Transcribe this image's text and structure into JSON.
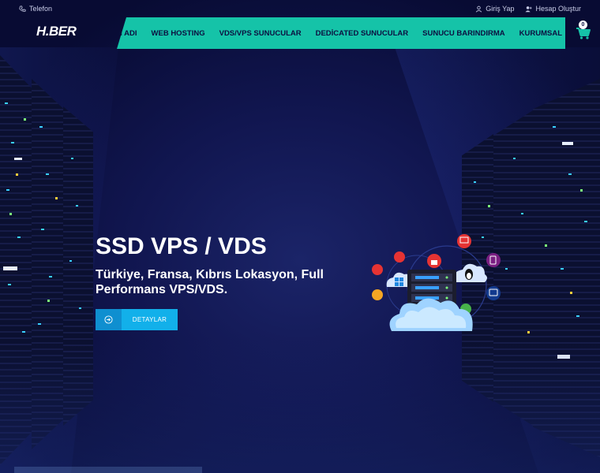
{
  "topbar": {
    "phone_label": "Telefon",
    "login_label": "Giriş Yap",
    "register_label": "Hesap Oluştur"
  },
  "header": {
    "logo_text": "H.BER",
    "nav": [
      {
        "label": "N ADI"
      },
      {
        "label": "WEB HOSTING"
      },
      {
        "label": "VDS/VPS SUNUCULAR"
      },
      {
        "label": "DEDİCATED SUNUCULAR"
      },
      {
        "label": "SUNUCU BARINDIRMA"
      },
      {
        "label": "KURUMSAL"
      }
    ],
    "cart_count": "0"
  },
  "hero": {
    "title": "SSD VPS / VDS",
    "subtitle": "Türkiye, Fransa, Kıbrıs Lokasyon, Full Performans VPS/VDS.",
    "cta_label": "DETAYLAR"
  },
  "colors": {
    "nav_bg": "#15c3a8",
    "nav_text": "#0c1040",
    "cta_dark": "#0f8fd0",
    "cta_light": "#12b0ea",
    "page_bg": "#0a0e3a"
  },
  "icons": {
    "phone": "phone-icon",
    "login": "user-icon",
    "register": "user-plus-icon",
    "cart": "shopping-cart-icon",
    "cta": "arrow-circle-icon"
  }
}
